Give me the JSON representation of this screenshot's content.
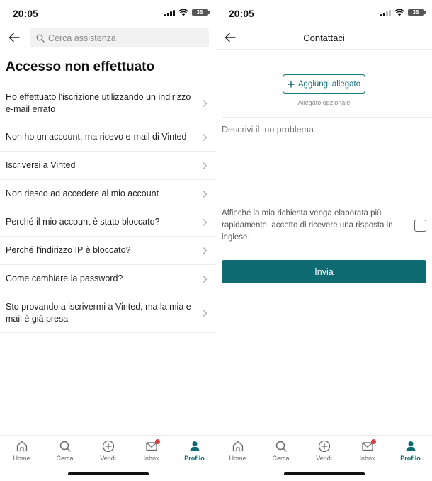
{
  "left": {
    "status": {
      "time": "20:05",
      "battery": "36"
    },
    "search": {
      "placeholder": "Cerca assistenza"
    },
    "title": "Accesso non effettuato",
    "faq_items": [
      "Ho effettuato l'iscrizione utilizzando un indirizzo e-mail errato",
      "Non ho un account, ma ricevo e-mail di Vinted",
      "Iscriversi a Vinted",
      "Non riesco ad accedere al mio account",
      "Perché il mio account è stato bloccato?",
      "Perché l'indirizzo IP è bloccato?",
      "Come cambiare la password?",
      "Sto provando a iscrivermi a Vinted, ma la mia e-mail è già presa"
    ]
  },
  "right": {
    "status": {
      "time": "20:05",
      "battery": "36"
    },
    "title": "Contattaci",
    "attach_label": "Aggiungi allegato",
    "attach_hint": "Allegato opzionale",
    "description_placeholder": "Descrivi il tuo problema",
    "consent_text": "Affinché la mia richiesta venga elaborata più rapidamente, accetto di ricevere una risposta in inglese.",
    "send_label": "Invia"
  },
  "tabbar": {
    "items": [
      {
        "label": "Home",
        "icon": "home-icon"
      },
      {
        "label": "Cerca",
        "icon": "search-icon"
      },
      {
        "label": "Vendi",
        "icon": "plus-circle-icon"
      },
      {
        "label": "Inbox",
        "icon": "mail-icon"
      },
      {
        "label": "Profilo",
        "icon": "profile-icon"
      }
    ],
    "active": "Profilo"
  },
  "colors": {
    "accent": "#0f6b72",
    "badge": "#e43c3c",
    "divider": "#ececec"
  }
}
